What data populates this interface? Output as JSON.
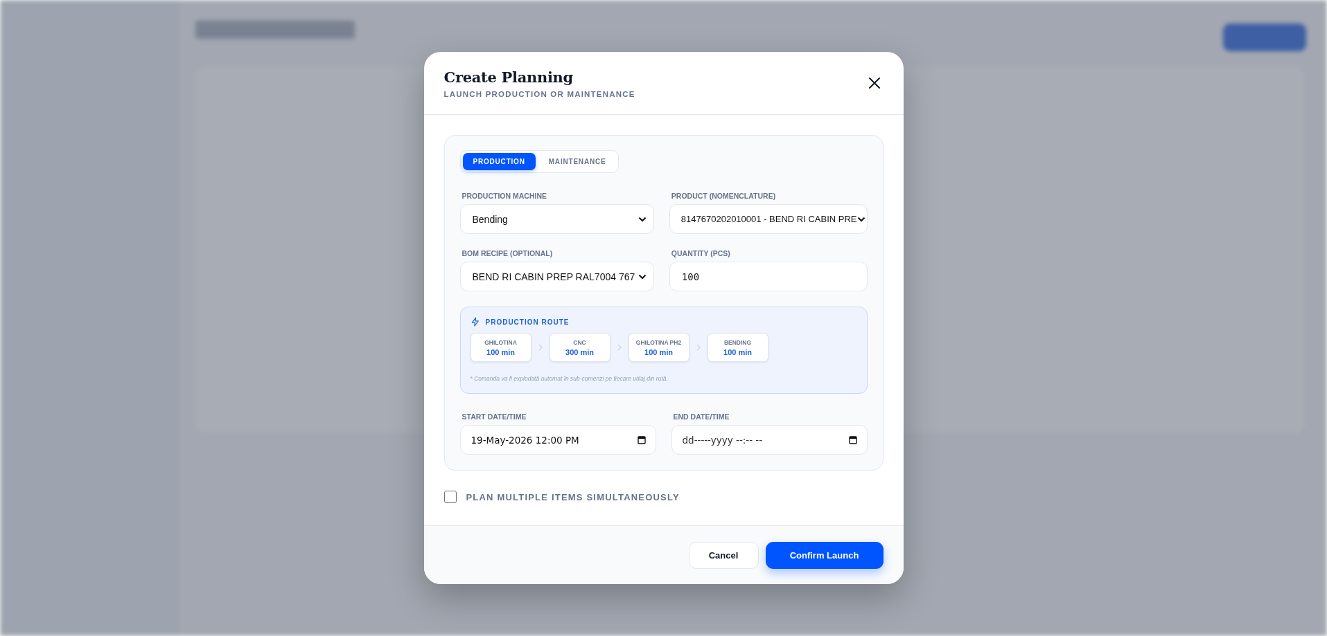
{
  "modal": {
    "title": "Create Planning",
    "subtitle": "LAUNCH PRODUCTION OR MAINTENANCE"
  },
  "mode_tabs": [
    {
      "label": "PRODUCTION",
      "selected": true
    },
    {
      "label": "MAINTENANCE",
      "selected": false
    }
  ],
  "machine": {
    "label": "PRODUCTION MACHINE",
    "value": "Bending"
  },
  "product": {
    "label": "PRODUCT (NOMENCLATURE)",
    "value": "8147670202010001 - BEND RI CABIN PRE"
  },
  "bom_recipe": {
    "label": "BOM RECIPE (OPTIONAL)",
    "value": "BEND RI CABIN PREP RAL7004 767"
  },
  "quantity": {
    "label": "QUANTITY (PCS)",
    "value": "100"
  },
  "route": {
    "title": "PRODUCTION ROUTE",
    "steps": [
      {
        "name": "GHILOTINA",
        "duration": "100 min"
      },
      {
        "name": "CNC",
        "duration": "300 min"
      },
      {
        "name": "GHILOTINA PH2",
        "duration": "100 min"
      },
      {
        "name": "BENDING",
        "duration": "100 min"
      }
    ],
    "note": "* Comanda va fi explodată automat în sub-comenzi pe fiecare utilaj din rută."
  },
  "start": {
    "label": "START DATE/TIME",
    "value": "19-May-2026 12:00 PM"
  },
  "end": {
    "label": "END DATE/TIME",
    "placeholder": "dd-----yyyy --:-- --"
  },
  "multi": {
    "label": "PLAN MULTIPLE ITEMS SIMULTANEOUSLY",
    "checked": false
  },
  "buttons": {
    "cancel": "Cancel",
    "confirm": "Confirm Launch"
  }
}
